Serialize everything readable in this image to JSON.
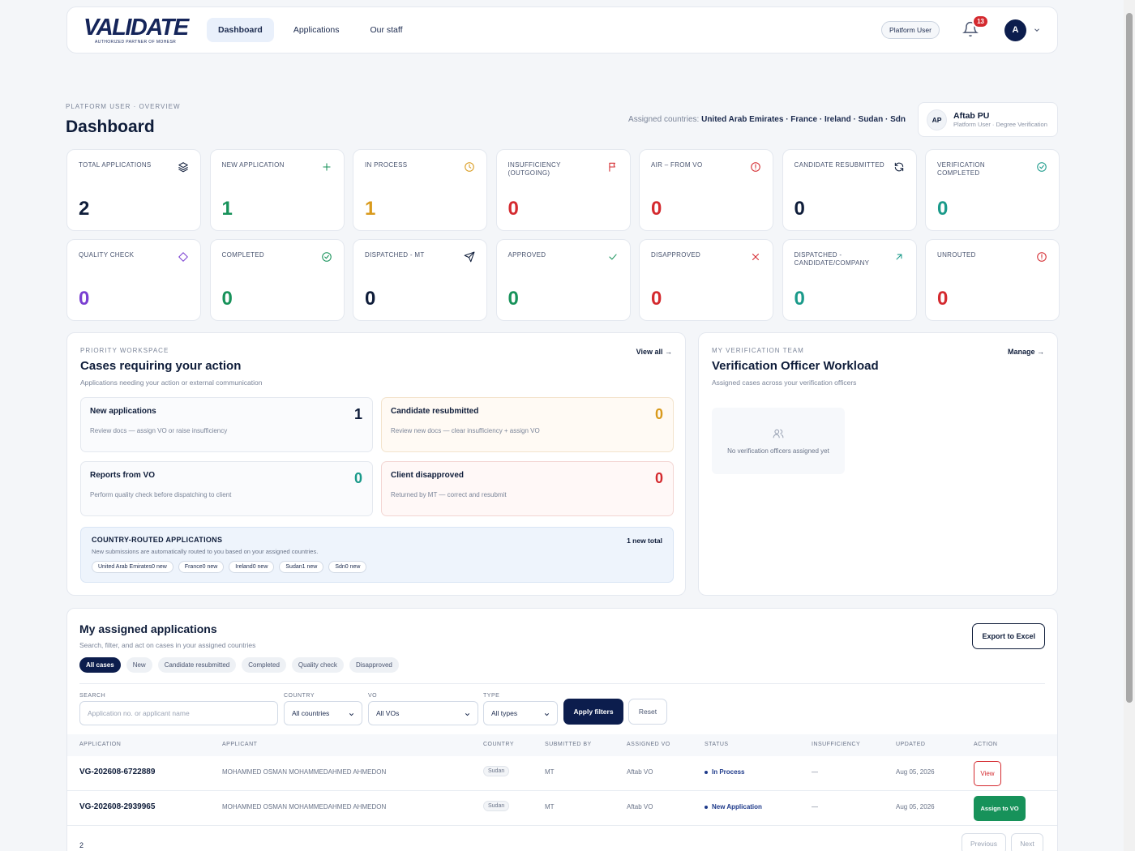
{
  "nav": {
    "logo_word": "VALIDATE",
    "logo_sub": "AUTHORIZED PARTNER OF MOHESR",
    "links": [
      {
        "label": "Dashboard",
        "active": true
      },
      {
        "label": "Applications",
        "active": false
      },
      {
        "label": "Our staff",
        "active": false
      }
    ],
    "role": "Platform User",
    "notification_count": "13",
    "avatar_letter": "A"
  },
  "header": {
    "breadcrumb": "PLATFORM USER · OVERVIEW",
    "title": "Dashboard",
    "assigned_label": "Assigned countries:",
    "assigned_countries": "United Arab Emirates · France · Ireland · Sudan · Sdn",
    "user_initials": "AP",
    "user_name": "Aftab PU",
    "user_sub": "Platform User · Degree Verification"
  },
  "stats_row1": [
    {
      "label": "TOTAL APPLICATIONS",
      "value": "2",
      "color": "#0f1d3a",
      "icon": "layers-icon"
    },
    {
      "label": "NEW APPLICATION",
      "value": "1",
      "color": "#17925a",
      "icon": "plus-icon"
    },
    {
      "label": "IN PROCESS",
      "value": "1",
      "color": "#d99a1c",
      "icon": "clock-icon"
    },
    {
      "label": "INSUFFICIENCY (OUTGOING)",
      "value": "0",
      "color": "#d42a2f",
      "icon": "flag-icon"
    },
    {
      "label": "AIR – FROM VO",
      "value": "0",
      "color": "#d42a2f",
      "icon": "alert-icon"
    },
    {
      "label": "CANDIDATE RESUBMITTED",
      "value": "0",
      "color": "#0f1d3a",
      "icon": "refresh-icon"
    },
    {
      "label": "VERIFICATION COMPLETED",
      "value": "0",
      "color": "#1a9a8a",
      "icon": "check-circle-icon"
    }
  ],
  "stats_row2": [
    {
      "label": "QUALITY CHECK",
      "value": "0",
      "color": "#7a3fd1",
      "icon": "diamond-icon"
    },
    {
      "label": "COMPLETED",
      "value": "0",
      "color": "#17925a",
      "icon": "check-circle-icon"
    },
    {
      "label": "DISPATCHED - MT",
      "value": "0",
      "color": "#0f1d3a",
      "icon": "send-icon"
    },
    {
      "label": "APPROVED",
      "value": "0",
      "color": "#17925a",
      "icon": "check-icon"
    },
    {
      "label": "DISAPPROVED",
      "value": "0",
      "color": "#d42a2f",
      "icon": "x-icon"
    },
    {
      "label": "DISPATCHED - CANDIDATE/COMPANY",
      "value": "0",
      "color": "#1a9a8a",
      "icon": "arrow-up-right-icon"
    },
    {
      "label": "UNROUTED",
      "value": "0",
      "color": "#d42a2f",
      "icon": "alert-icon"
    }
  ],
  "priority": {
    "eyebrow": "PRIORITY WORKSPACE",
    "title": "Cases requiring your action",
    "subtitle": "Applications needing your action or external communication",
    "view_all": "View all →",
    "cards": [
      {
        "title": "New applications",
        "sub": "Review docs — assign VO or raise insufficiency",
        "value": "1",
        "color": "#0f1d3a",
        "bg": "#fafbfd",
        "border": "#e4e8ef"
      },
      {
        "title": "Candidate resubmitted",
        "sub": "Review new docs — clear insufficiency + assign VO",
        "value": "0",
        "color": "#d99a1c",
        "bg": "#fffaf4",
        "border": "#f3e3cc"
      },
      {
        "title": "Reports from VO",
        "sub": "Perform quality check before dispatching to client",
        "value": "0",
        "color": "#1a9a8a",
        "bg": "#fafbfd",
        "border": "#e4e8ef"
      },
      {
        "title": "Client disapproved",
        "sub": "Returned by MT — correct and resubmit",
        "value": "0",
        "color": "#d42a2f",
        "bg": "#fff8f7",
        "border": "#f3d6d3"
      }
    ],
    "routed": {
      "title": "COUNTRY-ROUTED APPLICATIONS",
      "sub": "New submissions are automatically routed to you based on your assigned countries.",
      "total": "1 new total",
      "chips": [
        "United Arab Emirates0 new",
        "France0 new",
        "Ireland0 new",
        "Sudan1 new",
        "Sdn0 new"
      ]
    }
  },
  "team": {
    "eyebrow": "MY VERIFICATION TEAM",
    "title": "Verification Officer Workload",
    "subtitle": "Assigned cases across your verification officers",
    "manage": "Manage →",
    "empty": "No verification officers assigned yet"
  },
  "table": {
    "title": "My assigned applications",
    "subtitle": "Search, filter, and act on cases in your assigned countries",
    "export": "Export to Excel",
    "tabs": [
      "All cases",
      "New",
      "Candidate resubmitted",
      "Completed",
      "Quality check",
      "Disapproved"
    ],
    "filters": {
      "search_label": "SEARCH",
      "search_placeholder": "Application no. or applicant name",
      "country_label": "COUNTRY",
      "country_value": "All countries",
      "vo_label": "VO",
      "vo_value": "All VOs",
      "type_label": "TYPE",
      "type_value": "All types",
      "apply": "Apply filters",
      "reset": "Reset"
    },
    "columns": [
      "APPLICATION",
      "APPLICANT",
      "COUNTRY",
      "SUBMITTED BY",
      "ASSIGNED VO",
      "STATUS",
      "INSUFFICIENCY",
      "UPDATED",
      "ACTION"
    ],
    "rows": [
      {
        "app": "VG-202608-6722889",
        "applicant": "MOHAMMED OSMAN MOHAMMEDAHMED AHMEDON",
        "country": "Sudan",
        "by": "MT",
        "vo": "Aftab VO",
        "status": "In Process",
        "insuff": "—",
        "updated": "Aug 05, 2026",
        "action": "View"
      },
      {
        "app": "VG-202608-2939965",
        "applicant": "MOHAMMED OSMAN MOHAMMEDAHMED AHMEDON",
        "country": "Sudan",
        "by": "MT",
        "vo": "Aftab VO",
        "status": "New Application",
        "insuff": "—",
        "updated": "Aug 05, 2026",
        "action": "Assign to VO"
      }
    ],
    "count": "2",
    "prev": "Previous",
    "next": "Next"
  }
}
